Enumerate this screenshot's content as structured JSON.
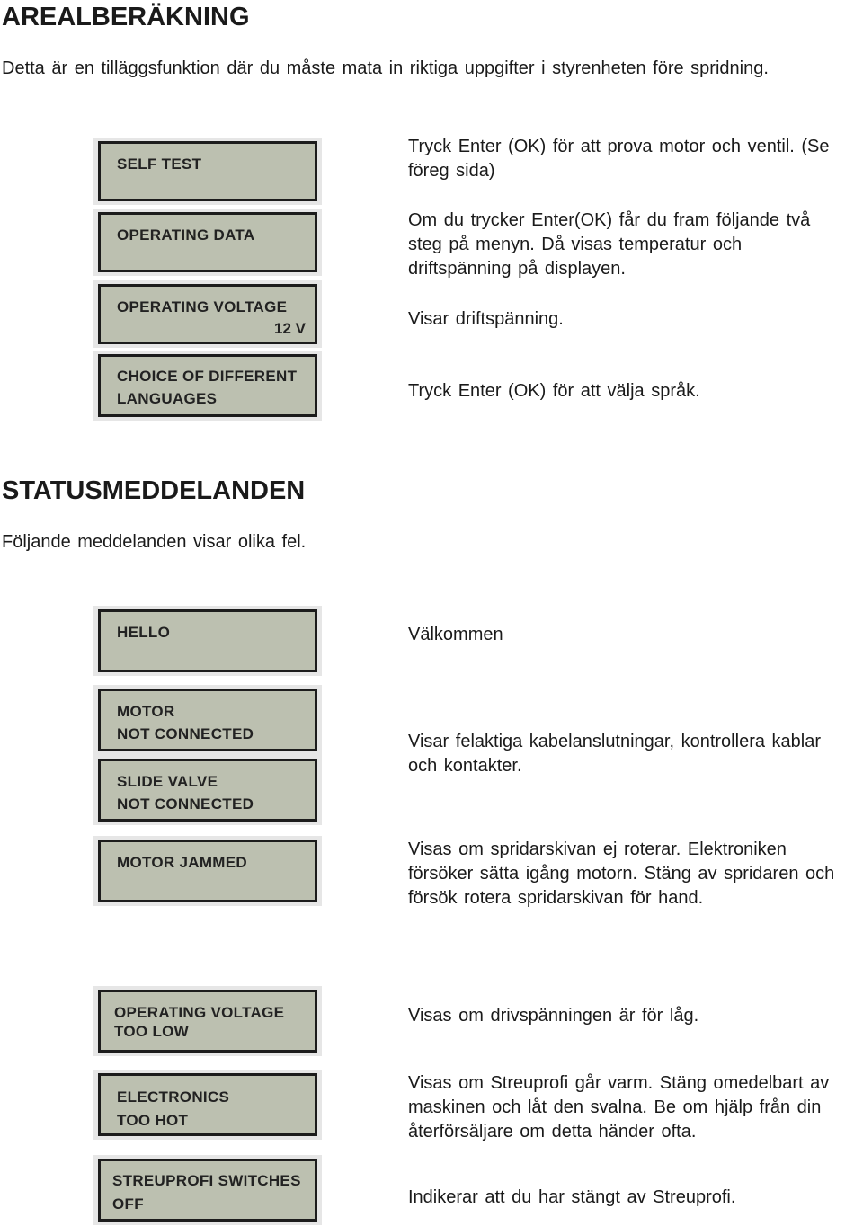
{
  "sections": {
    "area": {
      "title": "AREALBERÄKNING",
      "intro": "Detta är en tilläggsfunktion där du måste mata in riktiga uppgifter i styrenheten före spridning."
    },
    "status": {
      "title": "STATUSMEDDELANDEN",
      "intro": "Följande meddelanden visar olika fel."
    }
  },
  "menu_displays": [
    {
      "line1": "SELF TEST",
      "line2": ""
    },
    {
      "line1": "OPERATING DATA",
      "line2": ""
    },
    {
      "line1": "OPERATING VOLTAGE",
      "value": "12 V"
    },
    {
      "line1": "CHOICE OF DIFFERENT",
      "line2": "LANGUAGES"
    }
  ],
  "menu_descriptions": [
    "Tryck Enter (OK) för att prova motor och ventil. (Se föreg sida)",
    "Om du trycker Enter(OK) får du fram följande två steg på menyn. Då visas temperatur och driftspänning på displayen.",
    "Visar driftspänning.",
    "Tryck Enter (OK) för att välja språk."
  ],
  "status_displays": [
    {
      "line1": "HELLO",
      "line2": ""
    },
    {
      "line1": "MOTOR",
      "line2": "NOT CONNECTED"
    },
    {
      "line1": "SLIDE VALVE",
      "line2": "NOT CONNECTED"
    },
    {
      "line1": "MOTOR JAMMED",
      "line2": ""
    },
    {
      "line1": "OPERATING VOLTAGE",
      "line2": "TOO LOW"
    },
    {
      "line1": "ELECTRONICS",
      "line2": "TOO HOT"
    },
    {
      "line1": "STREUPROFI SWITCHES",
      "line2": "OFF"
    }
  ],
  "status_descriptions": [
    "Välkommen",
    "Visar felaktiga kabelanslutningar, kontrollera kablar och kontakter.",
    "Visas om spridarskivan ej roterar. Elektroniken försöker sätta igång motorn. Stäng av spridaren och försök rotera spridarskivan för hand.",
    "Visas om drivspänningen är för låg.",
    "Visas om Streuprofi går varm. Stäng omedelbart av maskinen och låt den svalna. Be om hjälp från din återförsäljare om detta händer ofta.",
    "Indikerar att du har stängt av Streuprofi."
  ]
}
